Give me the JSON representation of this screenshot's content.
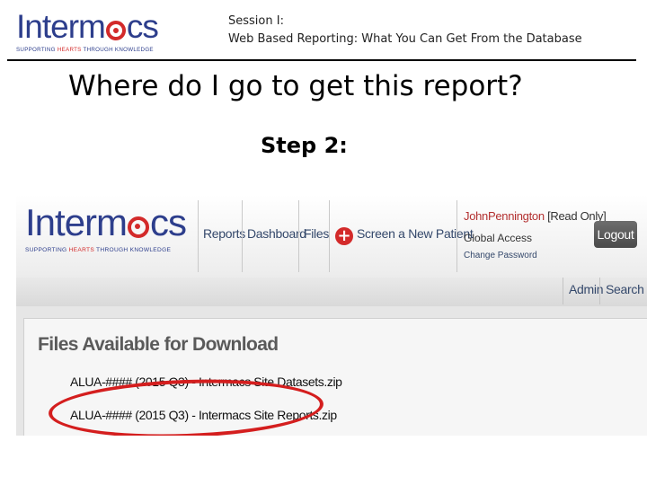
{
  "slide": {
    "logo_pre": "Interm",
    "logo_post": "cs",
    "tagline_pre": "SUPPORTING ",
    "tagline_red": "HEARTS",
    "tagline_post": " THROUGH KNOWLEDGE",
    "session_label": "Session I:",
    "session_title": "Web Based Reporting: What You Can Get From the Database",
    "title": "Where do I go to get this report?",
    "step": "Step 2:"
  },
  "app": {
    "nav": {
      "reports": "Reports",
      "dashboard": "Dashboard",
      "files": "Files",
      "screen_patient": "Screen a New Patient",
      "user_name": "JohnPennington",
      "user_role": "[Read Only]",
      "access": "Global Access",
      "change_password": "Change Password",
      "logout": "Logout"
    },
    "subnav": {
      "admin": "Admin",
      "search": "Search"
    },
    "files_section": {
      "title": "Files Available for Download",
      "items": [
        "ALUA-#### (2015 Q3) - Intermacs Site Datasets.zip",
        "ALUA-#### (2015 Q3) - Intermacs Site Reports.zip"
      ]
    },
    "colors": {
      "brand_blue": "#2d3e8c",
      "brand_red": "#d32a2a",
      "highlight_ellipse": "#d41e1e"
    }
  }
}
